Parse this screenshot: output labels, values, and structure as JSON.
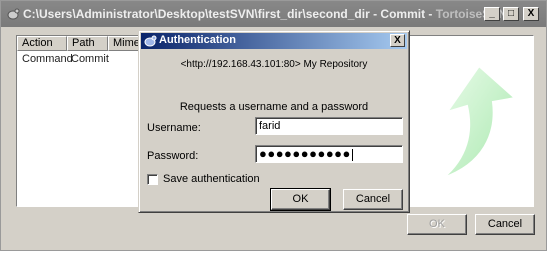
{
  "main_window": {
    "title_path": "C:\\Users\\Administrator\\Desktop\\testSVN\\first_dir\\second_dir - Commit - ",
    "title_app": "TortoiseSVN",
    "controls": {
      "minimize": "_",
      "maximize": "□",
      "close": "X"
    },
    "columns": [
      "Action",
      "Path",
      "Mime t"
    ],
    "rows": [
      {
        "action": "Command",
        "path": "Commit"
      }
    ],
    "buttons": {
      "ok": "OK",
      "cancel": "Cancel"
    }
  },
  "auth_dialog": {
    "title": "Authentication",
    "close": "X",
    "realm": "<http://192.168.43.101:80> My Repository",
    "prompt": "Requests a username and a password",
    "username_label": "Username:",
    "username_value": "farid",
    "password_label": "Password:",
    "password_mask": "●●●●●●●●●●●",
    "save_auth_label": "Save authentication",
    "save_auth_checked": false,
    "ok_label": "OK",
    "cancel_label": "Cancel"
  },
  "colors": {
    "titlebar_inactive": "#808080",
    "titlebar_active_start": "#0a246a",
    "titlebar_active_end": "#a6caf0",
    "face": "#d4d0c8",
    "arrow_green": "#b9f2bd"
  },
  "icons": {
    "main_title_icon": "tortoisesvn-icon",
    "auth_title_icon": "tortoisesvn-icon",
    "decoration": "curved-arrow-icon"
  }
}
